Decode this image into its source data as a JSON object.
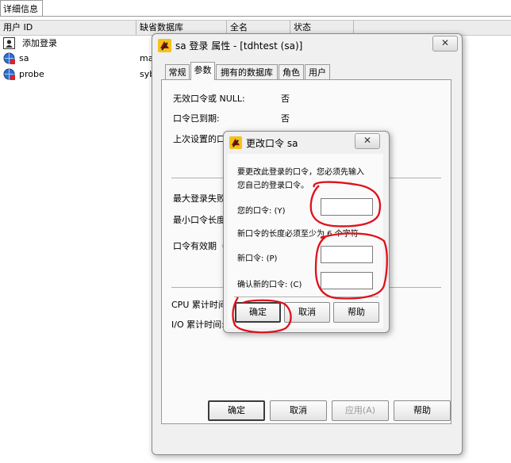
{
  "top_tab": {
    "label": "详细信息"
  },
  "list": {
    "columns": [
      "用户 ID",
      "缺省数据库",
      "全名",
      "状态"
    ],
    "rows": [
      {
        "name": "添加登录",
        "db": ""
      },
      {
        "name": "sa",
        "db": "ma"
      },
      {
        "name": "probe",
        "db": "syb"
      }
    ]
  },
  "prop_dialog": {
    "title": "sa 登录 属性 - [tdhtest (sa)]",
    "close": "✕",
    "tabs": [
      "常规",
      "参数",
      "拥有的数据库",
      "角色",
      "用户"
    ],
    "active_tab": 1,
    "fields": {
      "no_pwd_label": "无效口令或 NULL:",
      "no_pwd_value": "否",
      "expired_label": "口令已到期:",
      "expired_value": "否",
      "last_set_label": "上次设置的口",
      "max_fail_label": "最大登录失败",
      "min_len_label": "最小口令长度",
      "validity_label": "口令有效期（",
      "cpu_label": "CPU 累计时间",
      "io_label": "I/O 累计时间:"
    },
    "buttons": {
      "ok": "确定",
      "cancel": "取消",
      "apply": "应用(A)",
      "help": "帮助"
    }
  },
  "pwd_dialog": {
    "title": "更改口令 sa",
    "close": "✕",
    "intro_line1": "要更改此登录的口令，您必须先输入",
    "intro_line2": "您自己的登录口令。",
    "your_pwd_label": "您的口令:",
    "your_pwd_key": "(Y)",
    "min_len_note": "新口令的长度必须至少为 6 个字符",
    "new_pwd_label": "新口令:",
    "new_pwd_key": "(P)",
    "confirm_label": "确认新的口令:",
    "confirm_key": "(C)",
    "buttons": {
      "ok": "确定",
      "cancel": "取消",
      "help": "帮助"
    }
  },
  "colors": {
    "annotation": "#e0101a"
  }
}
